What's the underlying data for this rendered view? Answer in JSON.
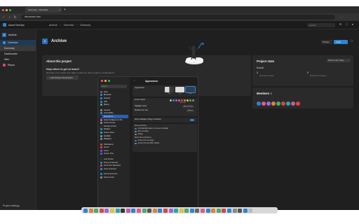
{
  "browser": {
    "tab_title": "Summary - Overview",
    "url": "dev.azure.com",
    "search_placeholder": "Search",
    "new_tab": "+",
    "close_glyph": "×",
    "back_glyph": "‹",
    "forward_glyph": "›",
    "reload_glyph": "↻"
  },
  "header": {
    "brand": "Azure DevOps",
    "breadcrumbs": [
      "Archive",
      "Overview",
      "Summary"
    ],
    "breadcrumb_sep": "/"
  },
  "sidebar": {
    "project_initial": "A",
    "project_name": "Archive",
    "items": [
      {
        "label": "Overview",
        "active": true,
        "icon_color": "#3b8fd9"
      },
      {
        "label": "Summary",
        "sub": true,
        "selected": true,
        "icon_color": ""
      },
      {
        "label": "Dashboards",
        "sub": true,
        "icon_color": ""
      },
      {
        "label": "Wiki",
        "sub": true,
        "icon_color": ""
      },
      {
        "label": "Repos",
        "icon_color": "#d9485f"
      }
    ],
    "footer": "Project settings"
  },
  "main": {
    "title_initial": "A",
    "title": "Archive",
    "private_label": "Private",
    "invite_label": "Invite",
    "star_glyph": "☆",
    "about": {
      "title": "About this project",
      "help": "Help others to get on board!",
      "sub": "Describe your project and make it easier for other people to understand it.",
      "button": "+ Add Project Description"
    },
    "stats": {
      "title": "Project stats",
      "range": "Period: Last 7 days",
      "boards_label": "Boards",
      "items": [
        {
          "number": "0",
          "sub": "Work items created"
        },
        {
          "number": "0",
          "sub": "Work items completed"
        }
      ]
    },
    "members": {
      "title": "Members",
      "count": "5",
      "avatar_colors": [
        "#2a86d4",
        "#e15a8c",
        "#9a6ad6",
        "#e0803a",
        "#4cab6a",
        "#d64545",
        "#2aa8a8",
        "#c45aa8",
        "#e04040"
      ]
    }
  },
  "settings": {
    "search_placeholder": "Search",
    "title": "Appearance",
    "nav_glyph": "‹ ›",
    "sidebar_items": [
      {
        "label": "ashyr",
        "color": "#6a6a6a"
      },
      {
        "label": "Bluetooth",
        "color": "#2a86d4"
      },
      {
        "label": "Network",
        "color": "#2a86d4"
      },
      {
        "label": "VPN",
        "color": "#2a86d4"
      },
      {
        "label": "Battery",
        "color": "#4cab6a"
      },
      {
        "gap": true
      },
      {
        "label": "General",
        "color": "#888"
      },
      {
        "label": "Accessibility",
        "color": "#2a86d4"
      },
      {
        "label": "Appearance",
        "color": "#222",
        "selected": true
      },
      {
        "label": "Apple Intelligence & Siri",
        "color": "#c45aa8"
      },
      {
        "label": "Control Centre",
        "color": "#888"
      },
      {
        "label": "Desktop & Dock",
        "color": "#333"
      },
      {
        "label": "Displays",
        "color": "#2a86d4"
      },
      {
        "label": "Screen Saver",
        "color": "#2aa8a8"
      },
      {
        "label": "Spotlight",
        "color": "#888"
      },
      {
        "label": "Wallpaper",
        "color": "#2aa8a8"
      },
      {
        "gap": true
      },
      {
        "label": "Notifications",
        "color": "#d64545"
      },
      {
        "label": "Sound",
        "color": "#d64545"
      },
      {
        "label": "Focus",
        "color": "#5a5ad6"
      },
      {
        "label": "Screen Time",
        "color": "#5a5ad6"
      },
      {
        "gap": true
      },
      {
        "label": "Lock Screen",
        "color": "#333"
      },
      {
        "label": "Privacy & Security",
        "color": "#2a86d4"
      },
      {
        "label": "Touch ID & Password",
        "color": "#d64545"
      },
      {
        "label": "Users & Groups",
        "color": "#2a86d4"
      },
      {
        "gap": true
      },
      {
        "label": "Internet Accounts",
        "color": "#2a86d4"
      },
      {
        "label": "Game Center",
        "color": "#888"
      }
    ],
    "appearance": {
      "label": "Appearance",
      "options": [
        {
          "caption": "Auto",
          "selected": false
        },
        {
          "caption": "Light",
          "selected": false
        },
        {
          "caption": "Dark",
          "selected": true
        }
      ]
    },
    "rows": {
      "accent_colour": "Accent colour",
      "accent_caption": "Multicolour",
      "accent_colors": [
        "#b0b0b0",
        "#2a86d4",
        "#9a6ad6",
        "#e15a8c",
        "#d64545",
        "#e0803a",
        "#e0c040",
        "#4cab6a",
        "#888888"
      ],
      "highlight_colour": "Highlight colour",
      "highlight_value": "Accent Colour",
      "sidebar_icon_size": "Sidebar icon size",
      "sidebar_icon_value": "Medium",
      "tinting": "Allow wallpaper tinting in windows",
      "show_scroll_bars": "Show scroll bars",
      "scroll_opts": [
        {
          "label": "Automatically based on mouse or trackpad",
          "on": true
        },
        {
          "label": "When scrolling",
          "on": false
        },
        {
          "label": "Always",
          "on": false
        }
      ],
      "click_scroll": "Click in the scroll bar to",
      "click_opts": [
        {
          "label": "Jump to the next page",
          "on": true
        },
        {
          "label": "Jump to the spot that's clicked",
          "on": false
        }
      ]
    }
  },
  "dock": {
    "colors": [
      "#2a86d4",
      "#e0803a",
      "#4cab6a",
      "#d64545",
      "#9a6ad6",
      "#e0c040",
      "#2aa8a8",
      "#333",
      "#c45aa8",
      "#2a86d4",
      "#e15a8c",
      "#4cab6a",
      "#555",
      "#e0803a",
      "#2a86d4",
      "#d64545",
      "#9a6ad6",
      "#2aa8a8",
      "#e0c040",
      "#4cab6a",
      "#2a86d4",
      "#666",
      "#e15a8c",
      "#2a86d4",
      "#e0803a",
      "#4cab6a",
      "#d64545",
      "#2a86d4",
      "#888",
      "#555",
      "#2a86d4",
      "#bbb"
    ]
  }
}
